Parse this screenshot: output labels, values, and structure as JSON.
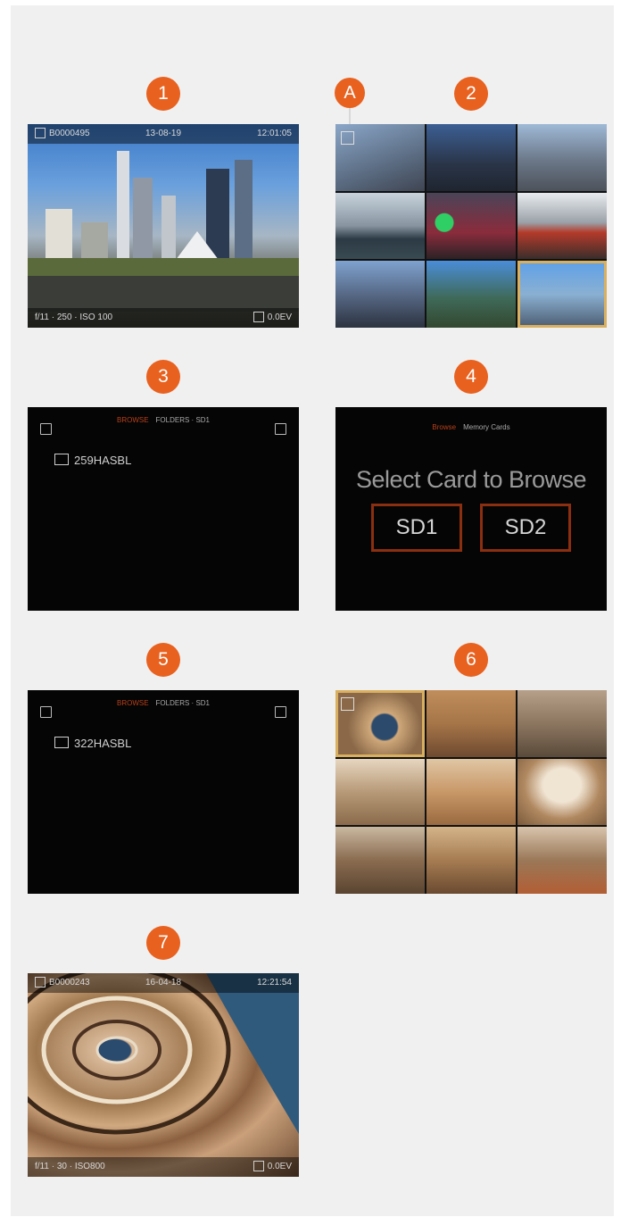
{
  "badges": {
    "b1": "1",
    "b2": "2",
    "b3": "3",
    "b4": "4",
    "b5": "5",
    "b6": "6",
    "b7": "7",
    "callout": "A"
  },
  "screen1": {
    "top": {
      "id": "B0000495",
      "date": "13-08-19",
      "time": "12:01:05"
    },
    "bottom": {
      "exposure": "f/11 · 250 · ISO 100",
      "ev": "0.0EV"
    }
  },
  "screen2": {
    "thumbnail_count": 9
  },
  "screen3": {
    "header_accent": "BROWSE",
    "header_path": "FOLDERS · SD1",
    "folder": "259HASBL"
  },
  "screen4": {
    "header_accent": "Browse",
    "header_path": "Memory Cards",
    "title": "Select Card to Browse",
    "cards": [
      "SD1",
      "SD2"
    ]
  },
  "screen5": {
    "header_accent": "BROWSE",
    "header_path": "FOLDERS · SD1",
    "folder": "322HASBL"
  },
  "screen6": {
    "thumbnail_count": 9
  },
  "screen7": {
    "top": {
      "id": "B0000243",
      "date": "16-04-18",
      "time": "12:21:54"
    },
    "bottom": {
      "exposure": "f/11 · 30 · ISO800",
      "ev": "0.0EV"
    }
  },
  "colors": {
    "accent": "#e8611f",
    "panel": "#f0f0f0",
    "card_border": "#8b2f10"
  }
}
